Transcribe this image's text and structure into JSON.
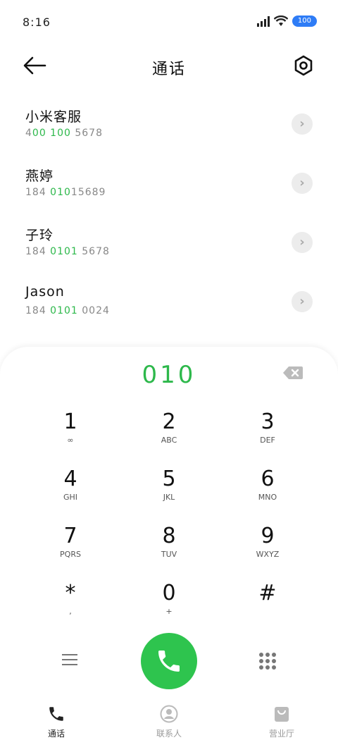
{
  "status": {
    "time": "8:16",
    "battery": "100"
  },
  "header": {
    "title": "通话",
    "back_icon": "arrow-left-icon",
    "settings_icon": "gear-icon"
  },
  "contacts": [
    {
      "name": "小米客服",
      "number_prefix": "4",
      "number_hl": "00 100",
      "number_suffix": " 5678"
    },
    {
      "name": "燕婷",
      "number_prefix": "184 ",
      "number_hl": "010",
      "number_suffix": "15689"
    },
    {
      "name": "子玲",
      "number_prefix": "184 ",
      "number_hl": "0101",
      "number_suffix": " 5678"
    },
    {
      "name": "Jason",
      "number_prefix": "184 ",
      "number_hl": "0101",
      "number_suffix": " 0024"
    }
  ],
  "dialer": {
    "entry": "010",
    "keys": [
      {
        "digit": "1",
        "letters": "∞"
      },
      {
        "digit": "2",
        "letters": "ABC"
      },
      {
        "digit": "3",
        "letters": "DEF"
      },
      {
        "digit": "4",
        "letters": "GHI"
      },
      {
        "digit": "5",
        "letters": "JKL"
      },
      {
        "digit": "6",
        "letters": "MNO"
      },
      {
        "digit": "7",
        "letters": "PQRS"
      },
      {
        "digit": "8",
        "letters": "TUV"
      },
      {
        "digit": "9",
        "letters": "WXYZ"
      },
      {
        "digit": "*",
        "letters": ","
      },
      {
        "digit": "0",
        "letters": "+"
      },
      {
        "digit": "#",
        "letters": ""
      }
    ]
  },
  "tabs": [
    {
      "label": "通话",
      "active": true
    },
    {
      "label": "联系人",
      "active": false
    },
    {
      "label": "营业厅",
      "active": false
    }
  ],
  "colors": {
    "accent": "#2db84b",
    "call_button": "#2ec44e",
    "battery": "#2e7cf6"
  }
}
